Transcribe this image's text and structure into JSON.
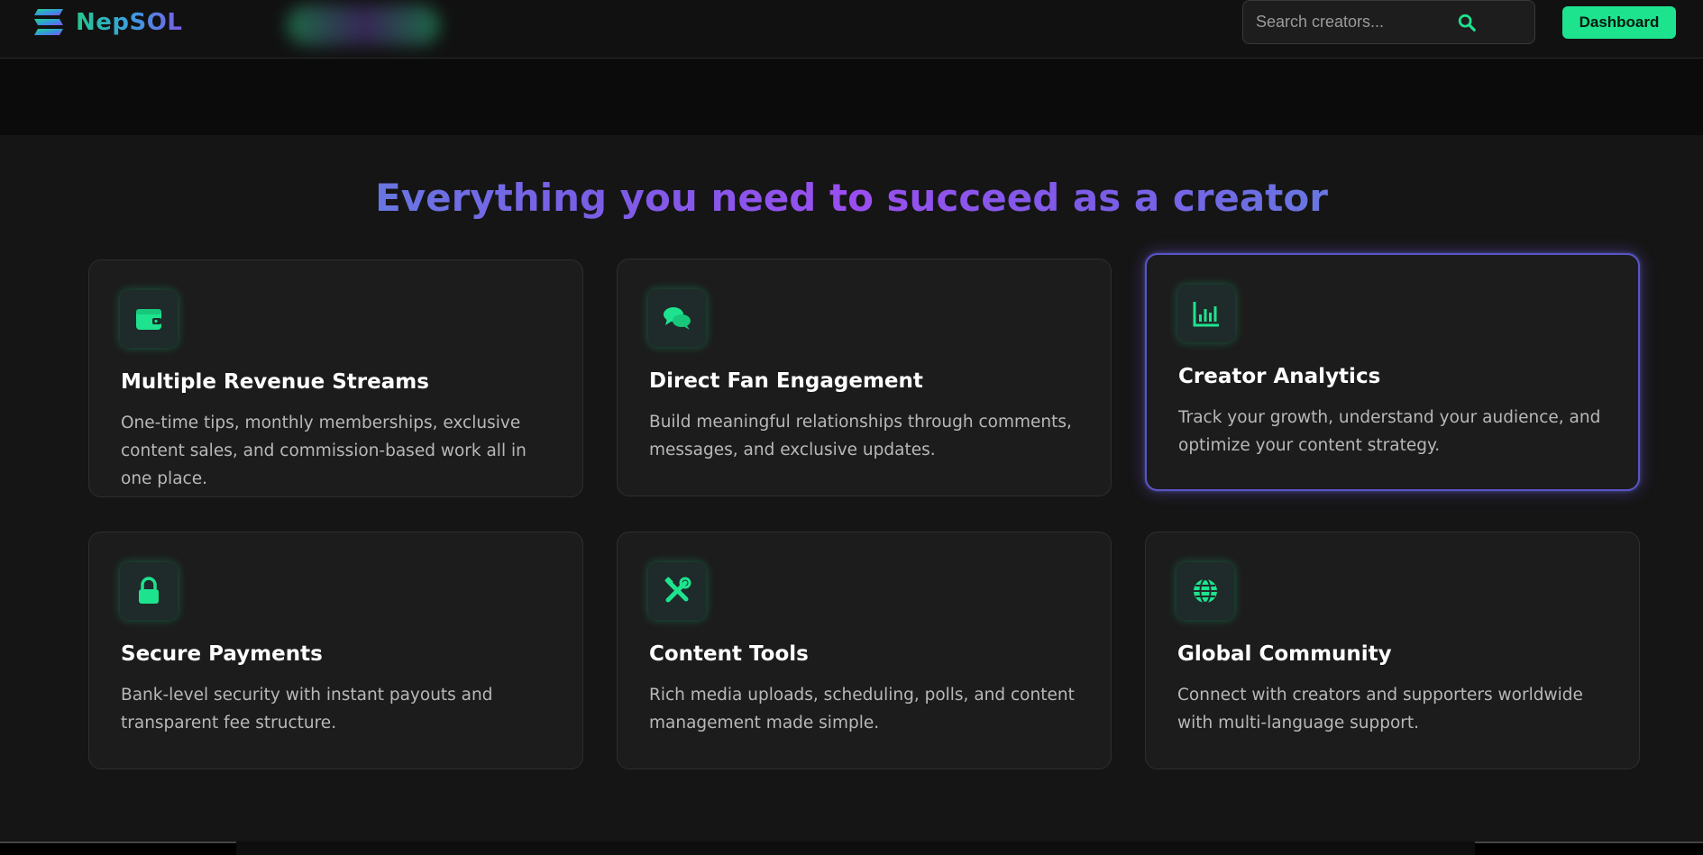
{
  "header": {
    "brand": "NepSOL",
    "search_placeholder": "Search creators...",
    "dashboard_label": "Dashboard"
  },
  "colors": {
    "accent": "#1ee38e",
    "purple": "#8b5cf6",
    "blue": "#4aa3d8"
  },
  "features": {
    "title": "Everything you need to succeed as a creator",
    "cards": [
      {
        "icon": "wallet-icon",
        "title": "Multiple Revenue Streams",
        "description": "One-time tips, monthly memberships, exclusive content sales, and commission-based work all in one place."
      },
      {
        "icon": "chat-icon",
        "title": "Direct Fan Engagement",
        "description": "Build meaningful relationships through comments, messages, and exclusive updates."
      },
      {
        "icon": "analytics-icon",
        "title": "Creator Analytics",
        "description": "Track your growth, understand your audience, and optimize your content strategy."
      },
      {
        "icon": "lock-icon",
        "title": "Secure Payments",
        "description": "Bank-level security with instant payouts and transparent fee structure."
      },
      {
        "icon": "tools-icon",
        "title": "Content Tools",
        "description": "Rich media uploads, scheduling, polls, and content management made simple."
      },
      {
        "icon": "globe-icon",
        "title": "Global Community",
        "description": "Connect with creators and supporters worldwide with multi-language support."
      }
    ]
  }
}
